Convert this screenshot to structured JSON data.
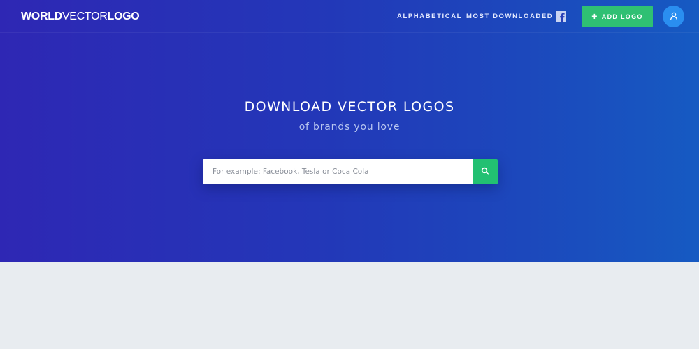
{
  "brand": {
    "part1": "WORLD",
    "part2": "VECTOR",
    "part3": "LOGO"
  },
  "nav": {
    "alphabetical": "ALPHABETICAL",
    "most_downloaded": "MOST DOWNLOADED",
    "add_logo": "ADD LOGO",
    "add_icon_glyph": "+"
  },
  "hero": {
    "title": "DOWNLOAD VECTOR LOGOS",
    "subtitle": "of brands you love"
  },
  "search": {
    "placeholder": "For example: Facebook, Tesla or Coca Cola",
    "value": ""
  },
  "icons": {
    "facebook": "facebook-icon",
    "user": "user-icon",
    "search": "search-icon",
    "plus": "plus-icon"
  },
  "colors": {
    "hero_left": "#2e27b4",
    "hero_right": "#165ac2",
    "accent_green": "#2fc073",
    "avatar_blue": "#2a8ef0",
    "page_bg": "#e8ecf0"
  }
}
